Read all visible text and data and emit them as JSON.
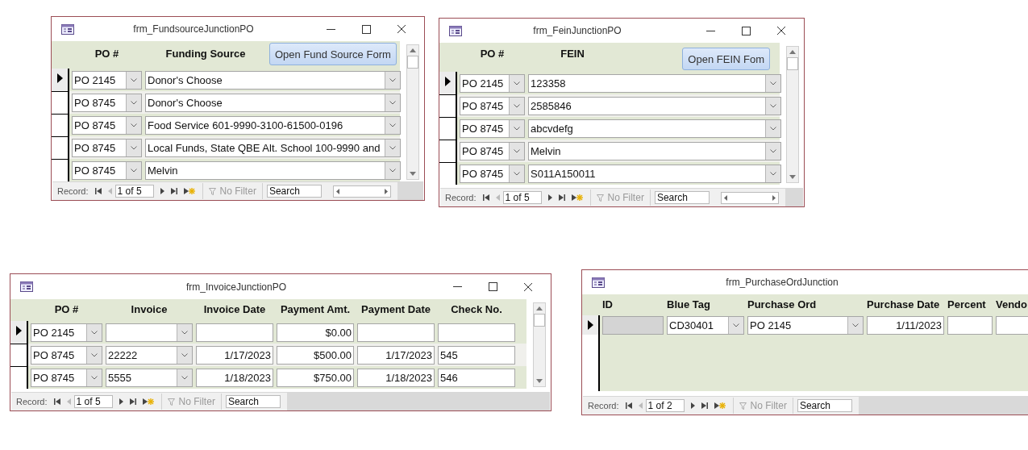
{
  "windows": [
    {
      "title": "frm_FundsourceJunctionPO",
      "controls": true,
      "vertical_scrollbar": true,
      "horizontal_scrollbar": true,
      "button": "Open Fund Source Form",
      "columns": [
        {
          "label": "PO #",
          "kind": "combo"
        },
        {
          "label": "Funding Source",
          "kind": "combo"
        }
      ],
      "rows": [
        {
          "selected": true,
          "cells": [
            "PO 2145",
            "Donor's Choose"
          ]
        },
        {
          "selected": false,
          "cells": [
            "PO 8745",
            "Donor's Choose"
          ]
        },
        {
          "selected": false,
          "cells": [
            "PO 8745",
            "Food Service 601-9990-3100-61500-0196"
          ]
        },
        {
          "selected": false,
          "cells": [
            "PO 8745",
            "Local Funds, State QBE Alt. School 100-9990 and"
          ]
        },
        {
          "selected": false,
          "cells": [
            "PO 8745",
            "Melvin"
          ]
        }
      ],
      "nav": {
        "label": "Record:",
        "position": "1 of 5",
        "filter": "No Filter",
        "search_placeholder": "Search",
        "previous_disabled": true,
        "filter_disabled": true
      }
    },
    {
      "title": "frm_FeinJunctionPO",
      "controls": true,
      "vertical_scrollbar": true,
      "horizontal_scrollbar": true,
      "button": "Open FEIN Fom",
      "columns": [
        {
          "label": "PO #",
          "kind": "combo"
        },
        {
          "label": "FEIN",
          "kind": "combo"
        }
      ],
      "rows": [
        {
          "selected": true,
          "cells": [
            "PO 2145",
            "123358"
          ]
        },
        {
          "selected": false,
          "cells": [
            "PO 8745",
            "2585846"
          ]
        },
        {
          "selected": false,
          "cells": [
            "PO 8745",
            "abcvdefg"
          ]
        },
        {
          "selected": false,
          "cells": [
            "PO 8745",
            "Melvin"
          ]
        },
        {
          "selected": false,
          "cells": [
            "PO 8745",
            "S011A150011"
          ]
        }
      ],
      "nav": {
        "label": "Record:",
        "position": "1 of 5",
        "filter": "No Filter",
        "search_placeholder": "Search",
        "previous_disabled": true,
        "filter_disabled": true
      }
    },
    {
      "title": "frm_InvoiceJunctionPO",
      "controls": true,
      "vertical_scrollbar": true,
      "horizontal_scrollbar": false,
      "columns": [
        {
          "label": "PO #",
          "kind": "combo"
        },
        {
          "label": "Invoice",
          "kind": "combo"
        },
        {
          "label": "Invoice Date",
          "kind": "date"
        },
        {
          "label": "Payment Amt.",
          "kind": "currency"
        },
        {
          "label": "Payment Date",
          "kind": "date"
        },
        {
          "label": "Check No.",
          "kind": "text"
        }
      ],
      "rows": [
        {
          "selected": true,
          "cells": [
            "PO 2145",
            null,
            null,
            "$0.00",
            null,
            null
          ]
        },
        {
          "selected": false,
          "cells": [
            "PO 8745",
            "22222",
            "1/17/2023",
            "$500.00",
            "1/17/2023",
            "545"
          ]
        },
        {
          "selected": false,
          "cells": [
            "PO 8745",
            "5555",
            "1/18/2023",
            "$750.00",
            "1/18/2023",
            "546"
          ]
        }
      ],
      "nav": {
        "label": "Record:",
        "position": "1 of 5",
        "filter": "No Filter",
        "search_placeholder": "Search",
        "previous_disabled": true,
        "filter_disabled": true
      }
    },
    {
      "title": "frm_PurchaseOrdJunction",
      "controls": false,
      "vertical_scrollbar": false,
      "horizontal_scrollbar": false,
      "columns": [
        {
          "label": "ID",
          "kind": "auto"
        },
        {
          "label": "Blue Tag",
          "kind": "combo"
        },
        {
          "label": "Purchase Ord",
          "kind": "combo"
        },
        {
          "label": "Purchase Date",
          "kind": "date"
        },
        {
          "label": "Percent",
          "kind": "text"
        },
        {
          "label": "Vendo",
          "kind": "text"
        }
      ],
      "rows": [
        {
          "selected": true,
          "cells": [
            null,
            "CD30401",
            "PO 2145",
            "1/11/2023",
            null,
            null
          ]
        }
      ],
      "nav": {
        "label": "Record:",
        "position": "1 of 2",
        "filter": "No Filter",
        "search_placeholder": "Search",
        "previous_disabled": true,
        "filter_disabled": true
      }
    }
  ]
}
